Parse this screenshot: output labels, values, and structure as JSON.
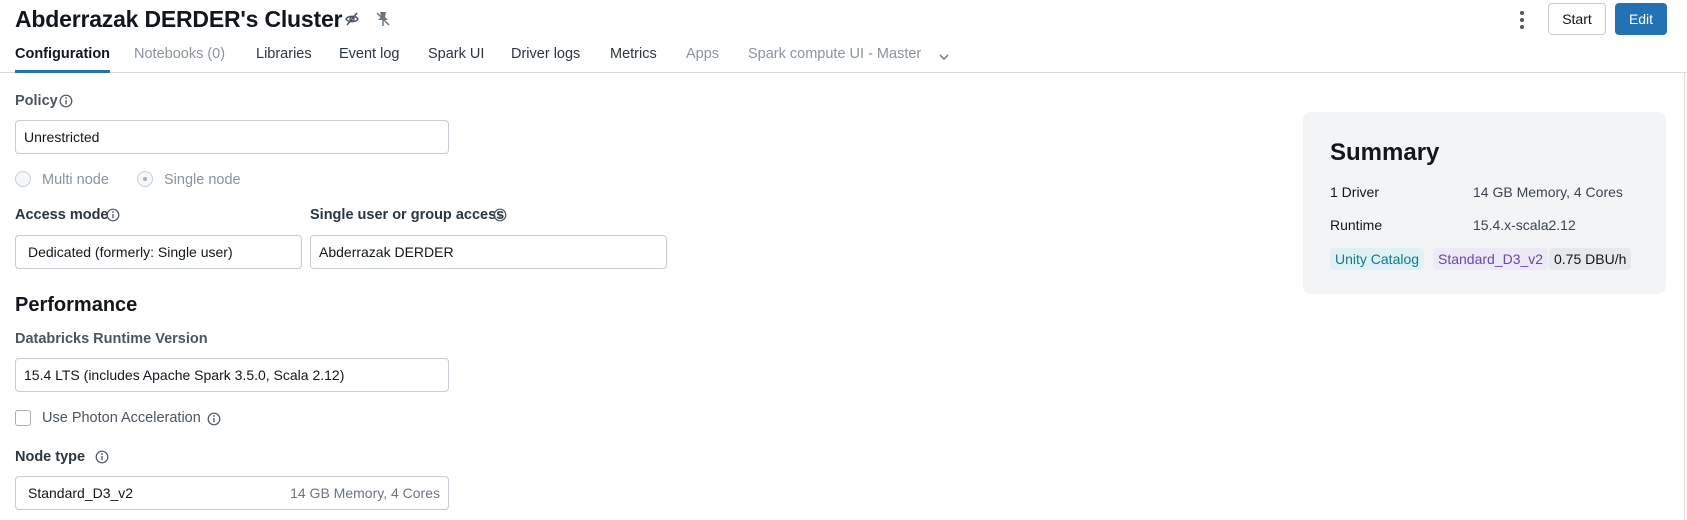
{
  "header": {
    "title": "Abderrazak DERDER's Cluster",
    "start_label": "Start",
    "edit_label": "Edit"
  },
  "tabs": [
    {
      "label": "Configuration",
      "state": "active"
    },
    {
      "label": "Notebooks (0)",
      "state": "disabled"
    },
    {
      "label": "Libraries",
      "state": "enabled"
    },
    {
      "label": "Event log",
      "state": "enabled"
    },
    {
      "label": "Spark UI",
      "state": "enabled"
    },
    {
      "label": "Driver logs",
      "state": "enabled"
    },
    {
      "label": "Metrics",
      "state": "enabled"
    },
    {
      "label": "Apps",
      "state": "disabled"
    },
    {
      "label": "Spark compute UI - Master",
      "state": "disabled"
    }
  ],
  "policy": {
    "label": "Policy",
    "value": "Unrestricted"
  },
  "node_mode": {
    "multi_label": "Multi node",
    "single_label": "Single node",
    "selected": "single"
  },
  "access": {
    "mode_label": "Access mode",
    "mode_value": "Dedicated (formerly: Single user)",
    "user_label": "Single user or group access",
    "user_value": "Abderrazak DERDER"
  },
  "performance": {
    "title": "Performance",
    "runtime_label": "Databricks Runtime Version",
    "runtime_value": "15.4 LTS (includes Apache Spark 3.5.0, Scala 2.12)",
    "photon_label": "Use Photon Acceleration",
    "photon_checked": false,
    "node_type_label": "Node type",
    "node_type_value": "Standard_D3_v2",
    "node_type_spec": "14 GB Memory, 4 Cores"
  },
  "summary": {
    "title": "Summary",
    "driver_key": "1 Driver",
    "driver_value": "14 GB Memory, 4 Cores",
    "runtime_key": "Runtime",
    "runtime_value": "15.4.x-scala2.12",
    "tags": [
      "Unity Catalog",
      "Standard_D3_v2",
      "0.75 DBU/h"
    ]
  },
  "colors": {
    "primary": "#2272b4",
    "tab_underline": "#2272b4",
    "summary_bg": "#f2f4f6"
  },
  "icons": [
    "eye-off-icon",
    "pin-off-icon",
    "kebab-menu-icon",
    "chevron-down-icon",
    "info-icon"
  ]
}
